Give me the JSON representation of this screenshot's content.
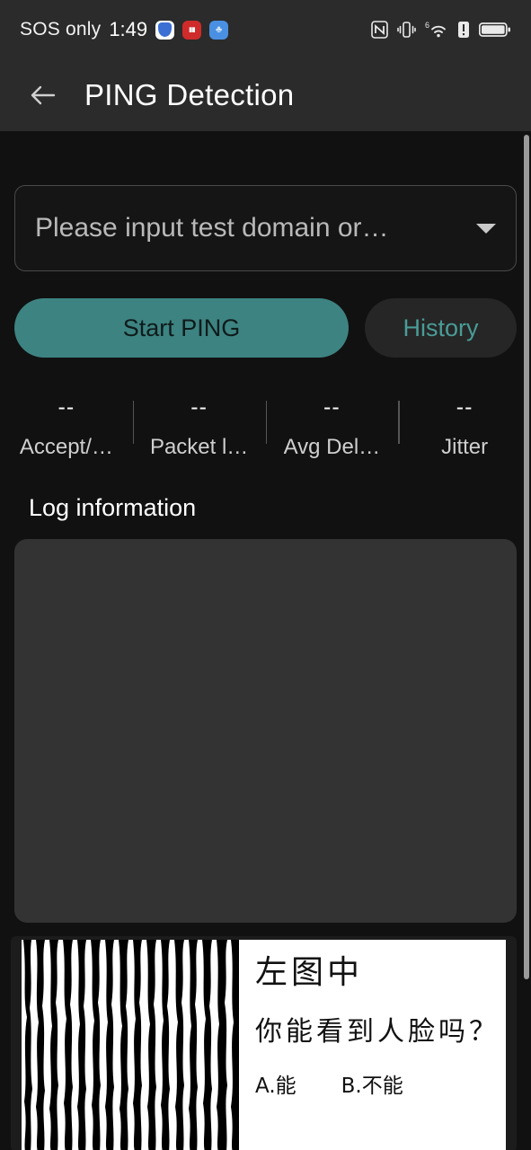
{
  "statusbar": {
    "carrier": "SOS only",
    "time": "1:49",
    "app_icons": [
      {
        "name": "shield-app-icon",
        "label": ""
      },
      {
        "name": "red-app-icon",
        "label": "ab"
      },
      {
        "name": "blue-app-icon",
        "label": "◡"
      }
    ],
    "right_icons": [
      "nfc-icon",
      "vibrate-icon",
      "wifi-6-icon",
      "alert-icon",
      "battery-icon"
    ],
    "wifi_generation": "6"
  },
  "appbar": {
    "back_label": "←",
    "title": "PING Detection"
  },
  "form": {
    "domain_placeholder": "Please input test domain or…",
    "domain_value": "",
    "dropdown_icon": "chevron-down-icon"
  },
  "actions": {
    "start_label": "Start PING",
    "history_label": "History"
  },
  "stats": [
    {
      "value": "--",
      "label": "Accept/…"
    },
    {
      "value": "--",
      "label": "Packet l…"
    },
    {
      "value": "--",
      "label": "Avg Del…"
    },
    {
      "value": "--",
      "label": "Jitter"
    }
  ],
  "log": {
    "title": "Log information",
    "content": ""
  },
  "ad": {
    "line1": "左图中",
    "line2": "你能看到人脸吗？",
    "option_a": "A.能",
    "option_b": "B.不能"
  },
  "colors": {
    "accent_teal": "#3d8381",
    "history_text": "#4a9c97",
    "page_bg": "#111111",
    "bar_bg": "#2b2b2b",
    "log_bg": "#333333"
  }
}
